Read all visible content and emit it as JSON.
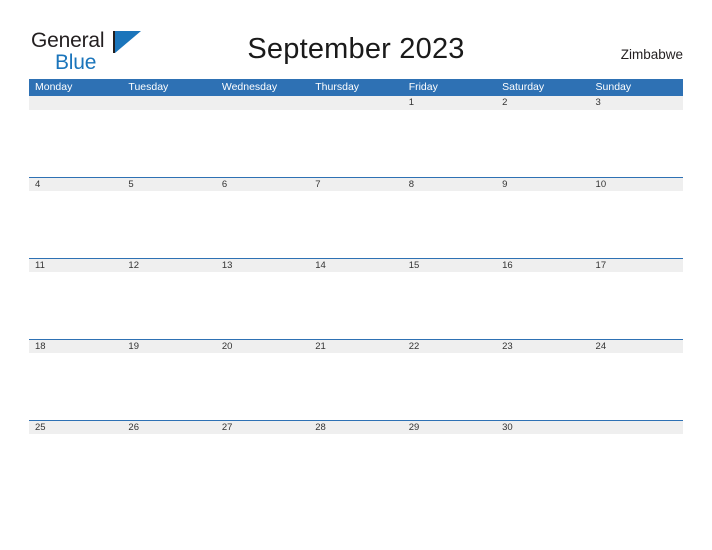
{
  "brand": {
    "name_part1": "General",
    "name_part2": "Blue",
    "flag_icon": "blue-flag-icon",
    "accent_color": "#1b75bb"
  },
  "header": {
    "title": "September 2023",
    "region": "Zimbabwe"
  },
  "colors": {
    "header_blue": "#2e71b4",
    "band_gray": "#efefef",
    "rule_blue": "#2e71b4",
    "text_dark": "#333333"
  },
  "calendar": {
    "month": "September",
    "year": "2023",
    "weekday_headers": [
      "Monday",
      "Tuesday",
      "Wednesday",
      "Thursday",
      "Friday",
      "Saturday",
      "Sunday"
    ],
    "weeks": [
      {
        "ruled": false,
        "days": [
          "",
          "",
          "",
          "",
          "1",
          "2",
          "3"
        ]
      },
      {
        "ruled": true,
        "days": [
          "4",
          "5",
          "6",
          "7",
          "8",
          "9",
          "10"
        ]
      },
      {
        "ruled": true,
        "days": [
          "11",
          "12",
          "13",
          "14",
          "15",
          "16",
          "17"
        ]
      },
      {
        "ruled": true,
        "days": [
          "18",
          "19",
          "20",
          "21",
          "22",
          "23",
          "24"
        ]
      },
      {
        "ruled": true,
        "days": [
          "25",
          "26",
          "27",
          "28",
          "29",
          "30",
          ""
        ]
      }
    ]
  }
}
